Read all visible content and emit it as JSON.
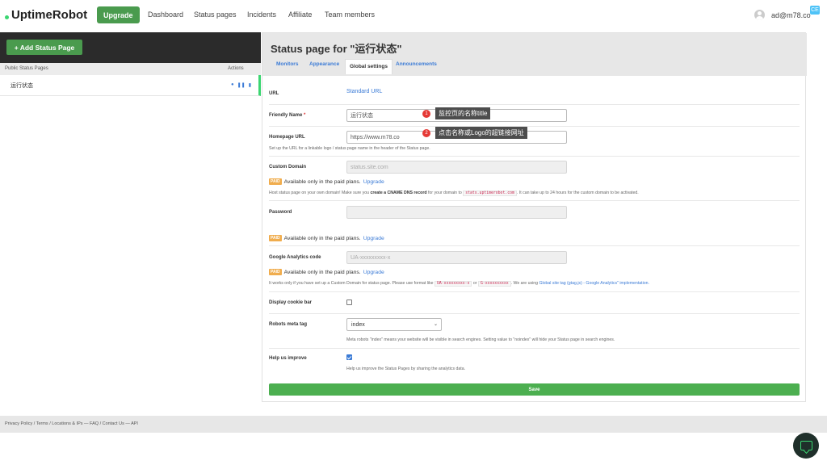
{
  "header": {
    "logo": "UptimeRobot",
    "upgrade": "Upgrade",
    "nav": [
      "Dashboard",
      "Status pages",
      "Incidents",
      "Affiliate",
      "Team members"
    ],
    "user": "ad@m78.co",
    "corner_badge": "CE"
  },
  "sidebar": {
    "add_button": "+  Add Status Page",
    "col_pages": "Public Status Pages",
    "col_actions": "Actions",
    "rows": [
      {
        "name": "运行状态"
      }
    ],
    "action_icons": [
      "eye-icon",
      "pause-icon",
      "trash-icon"
    ]
  },
  "main": {
    "title": "Status page for \"运行状态\"",
    "tabs": [
      "Monitors",
      "Appearance",
      "Global settings",
      "Announcements"
    ],
    "active_tab": "Global settings",
    "url": {
      "label": "URL",
      "value": "Standard URL"
    },
    "friendly_name": {
      "label": "Friendly Name",
      "required": "*",
      "value": "运行状态"
    },
    "homepage_url": {
      "label": "Homepage URL",
      "value": "https://www.m78.co",
      "help": "Set up the URL for a linkable logo / status page name in the header of the Status page."
    },
    "custom_domain": {
      "label": "Custom Domain",
      "placeholder": "status.site.com",
      "paid_text": "Available only in the paid plans.",
      "upgrade": "Upgrade",
      "help_1": "Host status page on your own domain! Make sure you",
      "help_bold": "create a CNAME DNS record",
      "help_2": "for your domain to",
      "help_code": "stats.uptimerobot.com",
      "help_3": ". It can take up to 24 hours for the custom domain to be activated."
    },
    "password": {
      "label": "Password",
      "paid_text": "Available only in the paid plans.",
      "upgrade": "Upgrade"
    },
    "analytics": {
      "label": "Google Analytics code",
      "placeholder": "UA-xxxxxxxxx-x",
      "paid_text": "Available only in the paid plans.",
      "upgrade": "Upgrade",
      "help_1": "It works only if you have set up a Custom Domain for status page. Please use format like",
      "code_1": "UA-xxxxxxxxx-x",
      "or": "or",
      "code_2": "G-xxxxxxxxxx",
      "help_2": ". We are using",
      "link": "Global site tag (gtag.js) - Google Analytics\" implementation."
    },
    "cookie_bar": {
      "label": "Display cookie bar",
      "checked": false
    },
    "robots": {
      "label": "Robots meta tag",
      "value": "index",
      "help": "Meta robots \"index\" means your website will be visible in search engines. Setting value to \"noindex\" will hide your Status page in search engines."
    },
    "help_improve": {
      "label": "Help us improve",
      "checked": true,
      "help": "Help us improve the Status Pages by sharing the analytics data."
    },
    "save": "Save",
    "paid_badge": "PAID"
  },
  "callouts": [
    {
      "num": "1",
      "text": "监控页的名称title"
    },
    {
      "num": "2",
      "text": "点击名称或Logo的超链接网址"
    }
  ],
  "footer": {
    "text": "Privacy Policy / Terms / Locations & IPs — FAQ / Contact Us — API"
  }
}
